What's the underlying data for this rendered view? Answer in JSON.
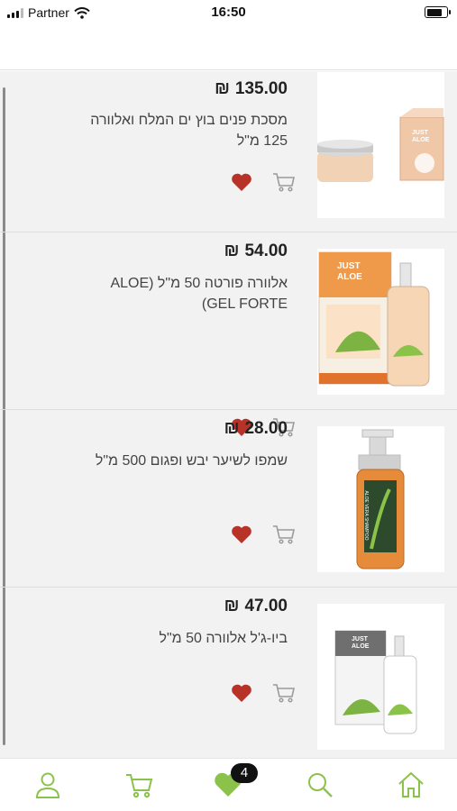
{
  "status_bar": {
    "carrier": "Partner",
    "time": "16:50",
    "battery_level": 0.8
  },
  "currency_symbol": "₪",
  "products": [
    {
      "price": "135.00",
      "title": "מסכת פנים בוץ ים המלח ואלוורה 125 מ\"ל"
    },
    {
      "price": "54.00",
      "title": "אלוורה פורטה 50 מ\"ל (ALOE GEL FORTE)"
    },
    {
      "price": "28.00",
      "title": "שמפו לשיער יבש ופגום 500 מ\"ל"
    },
    {
      "price": "47.00",
      "title": "ביו-ג'ל אלוורה 50 מ\"ל"
    }
  ],
  "product_images": [
    {
      "brand_line1": "JUST",
      "brand_line2": "ALOE"
    },
    {
      "brand_line1": "JUST",
      "brand_line2": "ALOE"
    },
    {
      "brand_line1": "ALOE VERA SHAMPOO"
    },
    {
      "brand_line1": "JUST",
      "brand_line2": "ALOE"
    }
  ],
  "nav": {
    "wishlist_badge": "4"
  },
  "colors": {
    "accent_green": "#8bc34a",
    "heart_red": "#b83227",
    "background": "#f2f2f2"
  },
  "icons": [
    "signal-icon",
    "wifi-icon",
    "battery-icon",
    "heart-icon",
    "cart-icon",
    "user-icon",
    "search-icon",
    "home-icon"
  ]
}
